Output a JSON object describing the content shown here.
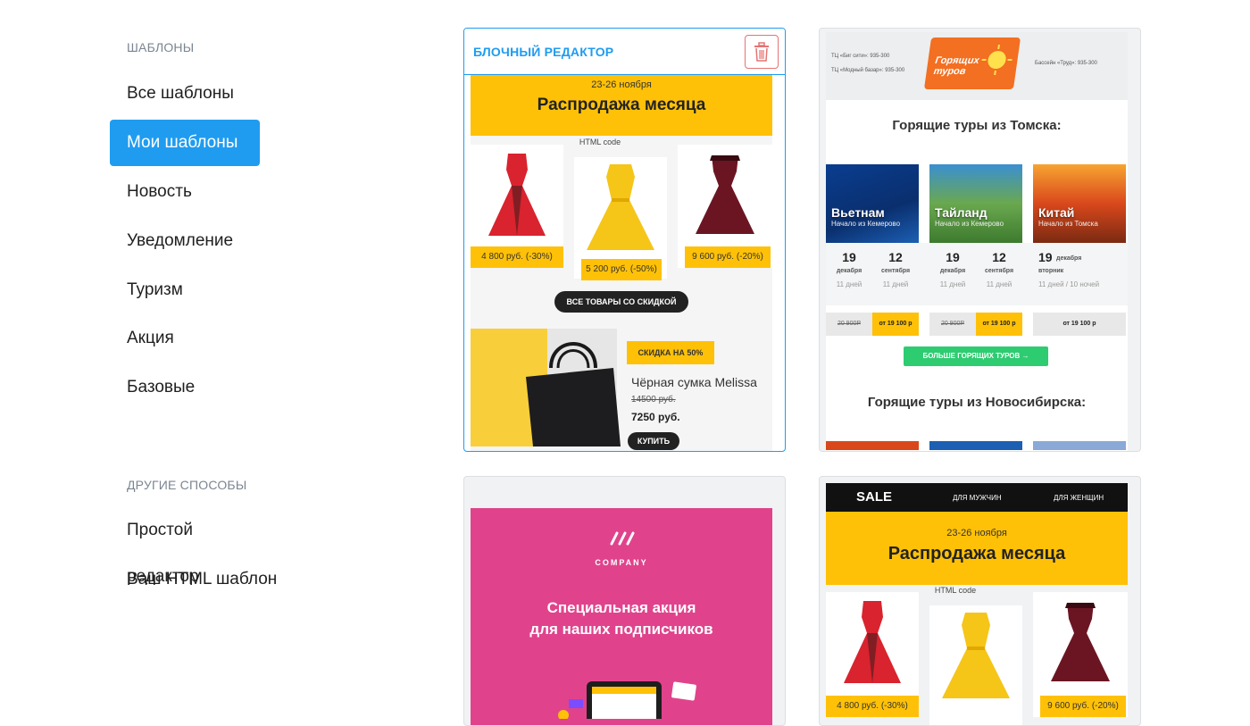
{
  "sidebar": {
    "templates_heading": "ШАБЛОНЫ",
    "items": [
      {
        "label": "Все шаблоны"
      },
      {
        "label": "Мои шаблоны"
      },
      {
        "label": "Новость"
      },
      {
        "label": "Уведомление"
      },
      {
        "label": "Туризм"
      },
      {
        "label": "Акция"
      },
      {
        "label": "Базовые"
      }
    ],
    "active_index": 1,
    "other_heading": "ДРУГИЕ СПОСОБЫ",
    "other_items": [
      {
        "label": "Простой редактор"
      },
      {
        "label": "Ваш HTML шаблон"
      }
    ]
  },
  "cards": {
    "card1": {
      "header_label": "БЛОЧНЫЙ РЕДАКТОР",
      "delete_icon": "trash-icon",
      "date": "23-26 ноября",
      "title": "Распродажа месяца",
      "html_code": "HTML code",
      "prices": [
        "4 800 руб. (-30%)",
        "5 200 руб. (-50%)",
        "9 600 руб. (-20%)"
      ],
      "cta": "ВСЕ ТОВАРЫ СО СКИДКОЙ",
      "discount": "СКИДКА НА 50%",
      "product_name": "Чёрная сумка Melissa",
      "old_price": "14500 руб.",
      "new_price": "7250 руб.",
      "buy": "КУПИТЬ"
    },
    "card2": {
      "contact1": "ТЦ «Биг сити»: 935-300",
      "contact2": "ТЦ «Модный базар»: 935-300",
      "contact3": "Бассейн «Труд»: 935-300",
      "logo_text": "Горящих туров",
      "heading1": "Горящие туры из Томска:",
      "tours": [
        {
          "name": "Вьетнам",
          "from": "Начало из Кемерово",
          "d1": "19",
          "m1": "декабря",
          "d2": "12",
          "m2": "сентября",
          "n1": "11 дней",
          "n2": "11 дней",
          "old": "20 900Р",
          "price": "от 19 100 р"
        },
        {
          "name": "Тайланд",
          "from": "Начало из Кемерово",
          "d1": "19",
          "m1": "декабря",
          "d2": "12",
          "m2": "сентября",
          "n1": "11 дней",
          "n2": "11 дней",
          "old": "20 900Р",
          "price": "от 19 100 р"
        },
        {
          "name": "Китай",
          "from": "Начало из Томска",
          "d1": "19",
          "m1": "декабря",
          "d2": "",
          "m2": "вторник",
          "n1": "11 дней / 10 ночей",
          "n2": "",
          "old": "",
          "price": "от 19 100 р"
        }
      ],
      "more_btn": "БОЛЬШЕ ГОРЯЩИХ ТУРОВ →",
      "heading2": "Горящие туры из Новосибирска:"
    },
    "card3": {
      "company": "COMPANY",
      "line1": "Специальная акция",
      "line2": "для наших подписчиков"
    },
    "card4": {
      "sale": "SALE",
      "men": "ДЛЯ МУЖЧИН",
      "women": "ДЛЯ ЖЕНЩИН",
      "date": "23-26 ноября",
      "title": "Распродажа месяца",
      "html_code": "HTML code",
      "prices": [
        "4 800 руб. (-30%)",
        "9 600 руб. (-20%)"
      ]
    }
  },
  "colors": {
    "accent": "#1f9cf0",
    "yellow": "#ffc107",
    "pink": "#e0438c",
    "green": "#2ecc71"
  }
}
